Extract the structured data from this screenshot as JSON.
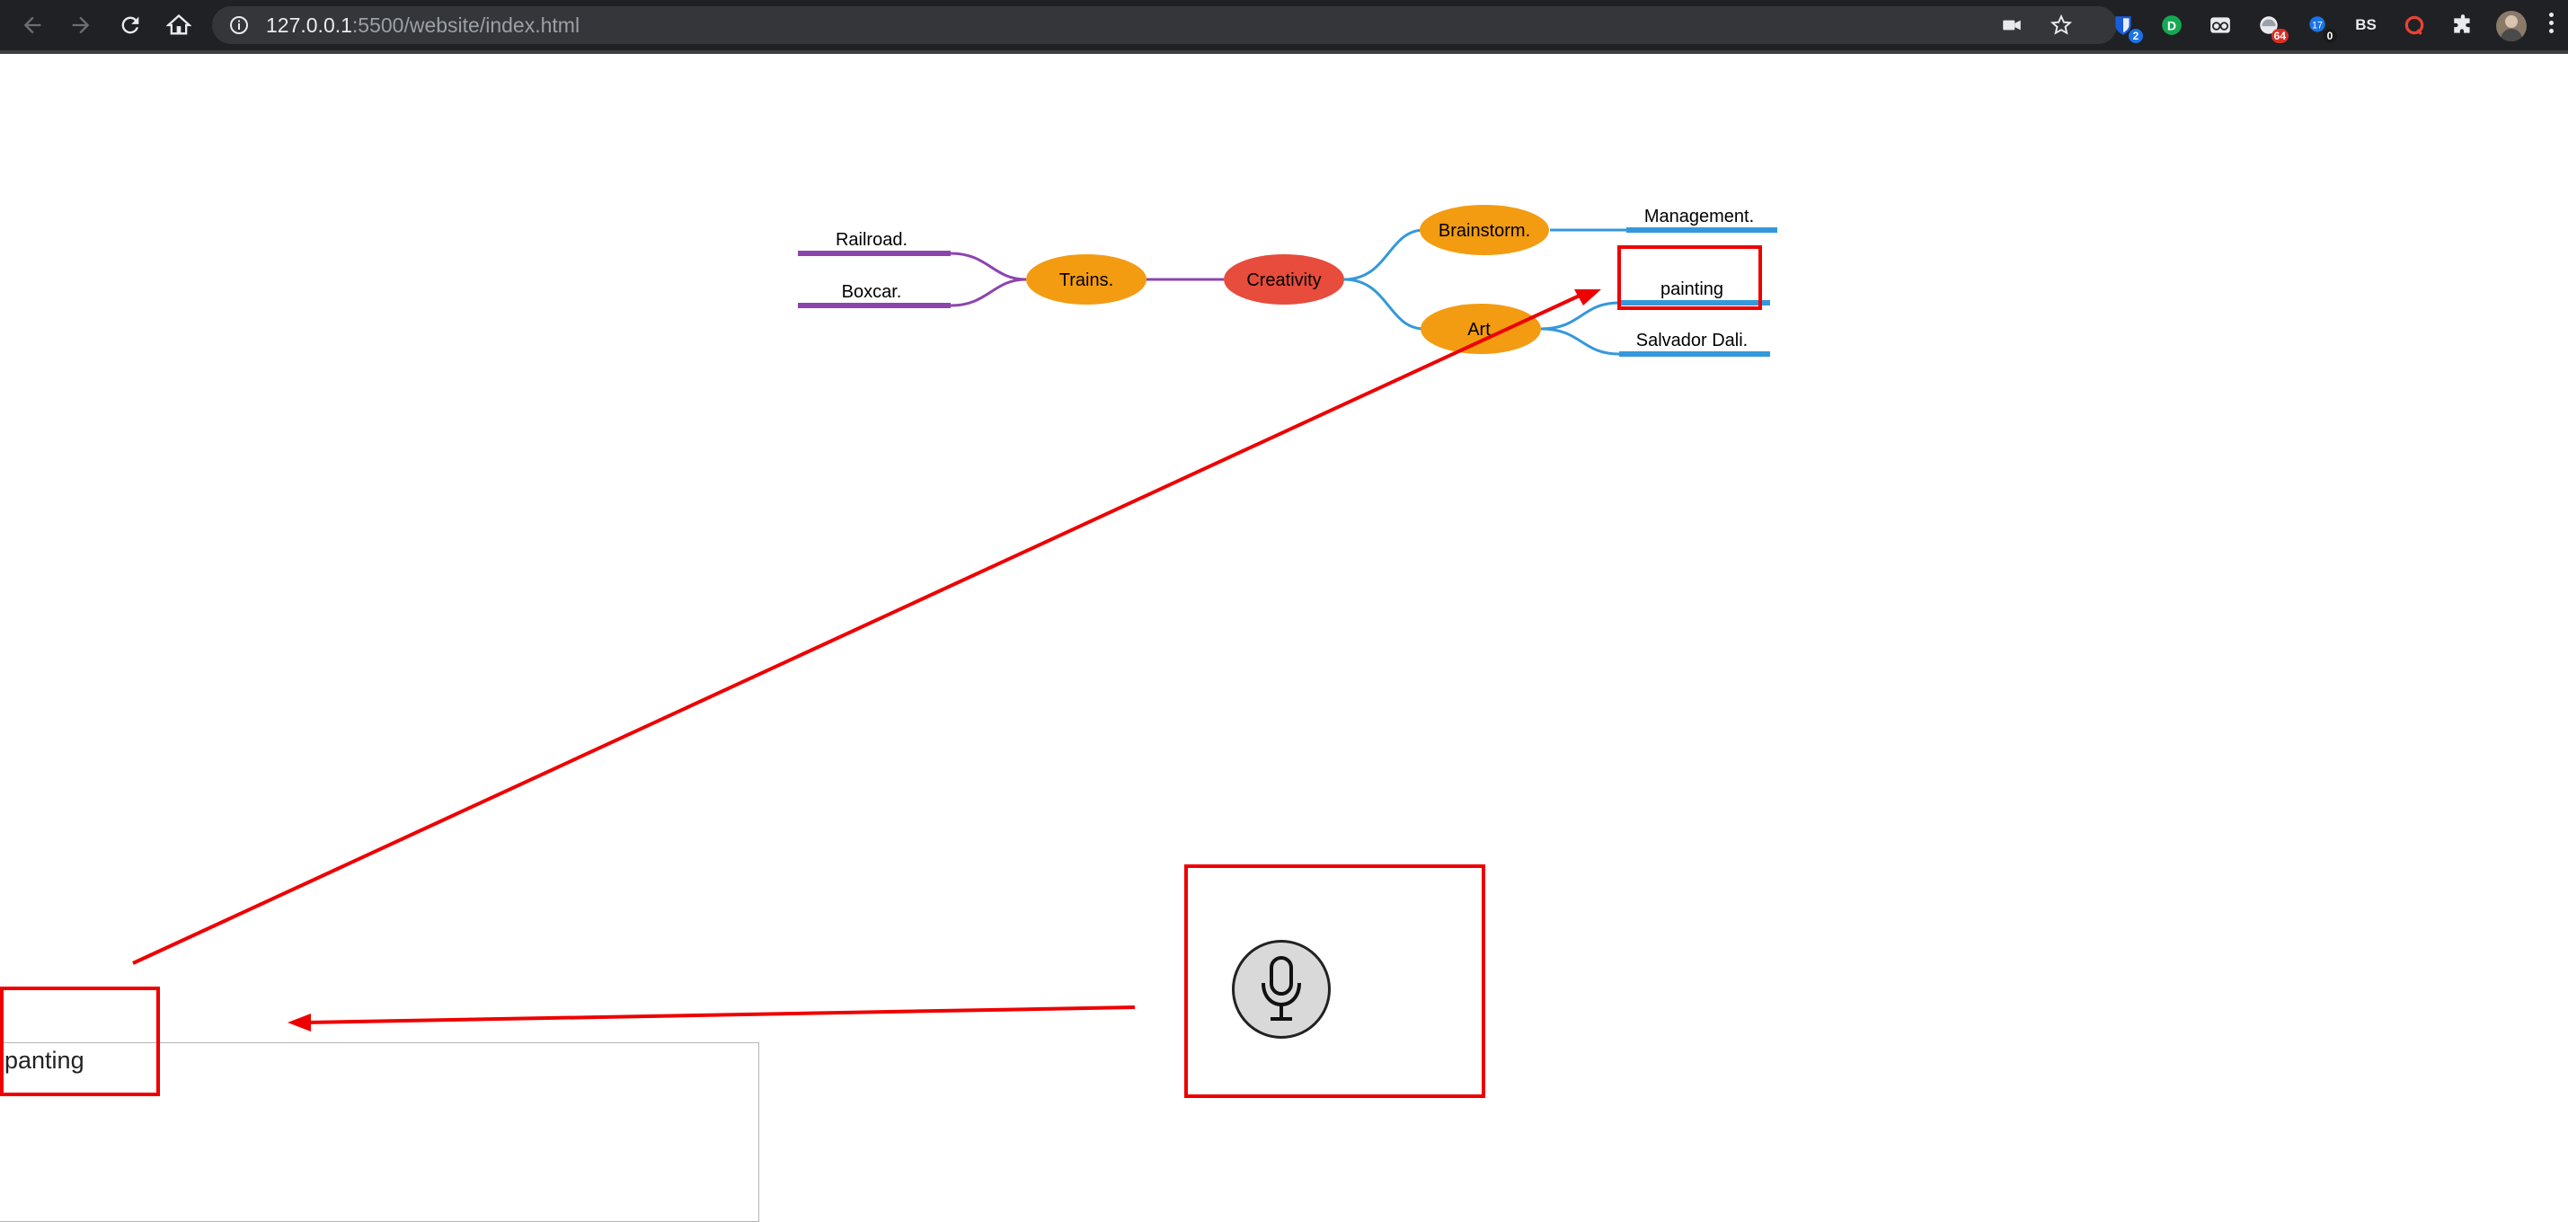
{
  "browser": {
    "url_host": "127.0.0.1",
    "url_rest": ":5500/website/index.html",
    "extensions": [
      {
        "name": "bitwarden-icon",
        "badge": "2",
        "badge_color": "#1a73e8"
      },
      {
        "name": "grammarly-icon",
        "badge": ""
      },
      {
        "name": "reader-icon",
        "badge": ""
      },
      {
        "name": "weather-icon",
        "badge": "64",
        "badge_color": "#d93025"
      },
      {
        "name": "blue-extension-icon",
        "badge": "0",
        "badge_color": "#1a1a1a"
      },
      {
        "name": "bs-extension-icon",
        "label": "BS"
      },
      {
        "name": "red-circle-extension-icon",
        "badge": ""
      },
      {
        "name": "extensions-puzzle-icon",
        "badge": ""
      }
    ]
  },
  "mindmap": {
    "root": {
      "label": "Creativity",
      "color": "#e74c3c"
    },
    "branch_color_left": "#8e44ad",
    "branch_color_right": "#3498db",
    "node_color": "#f39c12",
    "nodes": {
      "trains": "Trains.",
      "brainstorm": "Brainstorm.",
      "art": "Art"
    },
    "leaves": {
      "railroad": "Railroad.",
      "boxcar": "Boxcar.",
      "management": "Management.",
      "painting": "painting",
      "salvador_dali": "Salvador Dali."
    }
  },
  "speech": {
    "transcript": "panting",
    "mic_icon": "microphone-icon"
  },
  "annotations": {
    "color": "#ee0000"
  }
}
